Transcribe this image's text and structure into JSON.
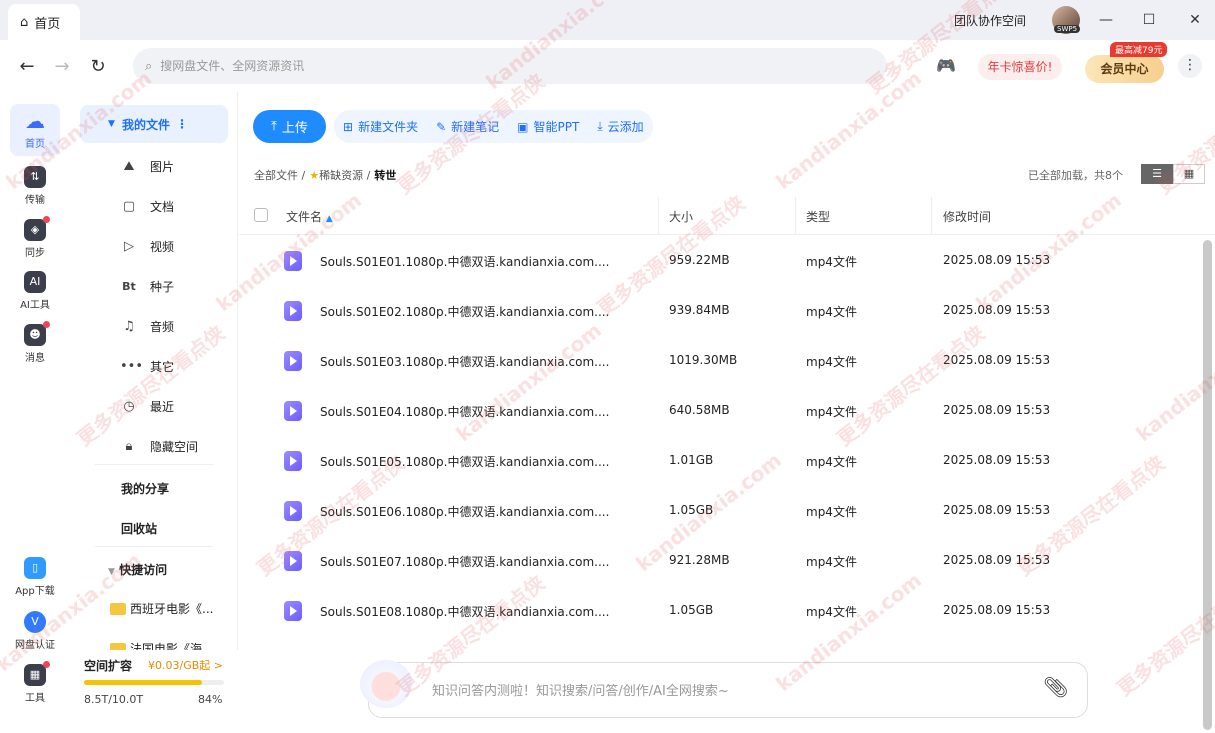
{
  "titlebar": {
    "tab_label": "首页",
    "team": "团队协作空间",
    "avatar_badge": "SWP5"
  },
  "nav": {
    "search_placeholder": "搜网盘文件、全网资源资讯",
    "promo": "年卡惊喜价!",
    "vip_badge": "最高减79元",
    "vip_label": "会员中心"
  },
  "rail": {
    "home": "首页",
    "transfer": "传输",
    "sync": "同步",
    "ai": "AI工具",
    "message": "消息",
    "app": "App下载",
    "auth": "网盘认证",
    "tools": "工具"
  },
  "sidebar": {
    "myfiles": "我的文件",
    "items": [
      "图片",
      "文档",
      "视频",
      "种子",
      "音频",
      "其它",
      "最近",
      "隐藏空间"
    ],
    "share": "我的分享",
    "recycle": "回收站",
    "quick": "快捷访问",
    "folders": [
      "西班牙电影《...",
      "法国电影《海"
    ]
  },
  "storage": {
    "title": "空间扩容",
    "price": "¥0.03/GB起 >",
    "used": "8.5T/10.0T",
    "pct": "84%",
    "fill_fraction": 0.84
  },
  "toolbar": {
    "upload": "上传",
    "newfolder": "新建文件夹",
    "newnote": "新建笔记",
    "ppt": "智能PPT",
    "cloudadd": "云添加"
  },
  "breadcrumb": {
    "root": "全部文件 /",
    "mid": "稀缺资源 /",
    "cur": "转世"
  },
  "loaded": "已全部加载，共8个",
  "columns": {
    "name": "文件名",
    "size": "大小",
    "type": "类型",
    "time": "修改时间"
  },
  "files": [
    {
      "name": "Souls.S01E01.1080p.中德双语.kandianxia.com....",
      "size": "959.22MB",
      "type": "mp4文件",
      "time": "2025.08.09 15:53"
    },
    {
      "name": "Souls.S01E02.1080p.中德双语.kandianxia.com....",
      "size": "939.84MB",
      "type": "mp4文件",
      "time": "2025.08.09 15:53"
    },
    {
      "name": "Souls.S01E03.1080p.中德双语.kandianxia.com....",
      "size": "1019.30MB",
      "type": "mp4文件",
      "time": "2025.08.09 15:53"
    },
    {
      "name": "Souls.S01E04.1080p.中德双语.kandianxia.com....",
      "size": "640.58MB",
      "type": "mp4文件",
      "time": "2025.08.09 15:53"
    },
    {
      "name": "Souls.S01E05.1080p.中德双语.kandianxia.com....",
      "size": "1.01GB",
      "type": "mp4文件",
      "time": "2025.08.09 15:53"
    },
    {
      "name": "Souls.S01E06.1080p.中德双语.kandianxia.com....",
      "size": "1.05GB",
      "type": "mp4文件",
      "time": "2025.08.09 15:53"
    },
    {
      "name": "Souls.S01E07.1080p.中德双语.kandianxia.com....",
      "size": "921.28MB",
      "type": "mp4文件",
      "time": "2025.08.09 15:53"
    },
    {
      "name": "Souls.S01E08.1080p.中德双语.kandianxia.com....",
      "size": "1.05GB",
      "type": "mp4文件",
      "time": "2025.08.09 15:53"
    }
  ],
  "ai_placeholder": "知识问答内测啦！知识搜索/问答/创作/AI全网搜索~",
  "watermarks": [
    "kandianxia.com",
    "更多资源尽在看点侠"
  ]
}
